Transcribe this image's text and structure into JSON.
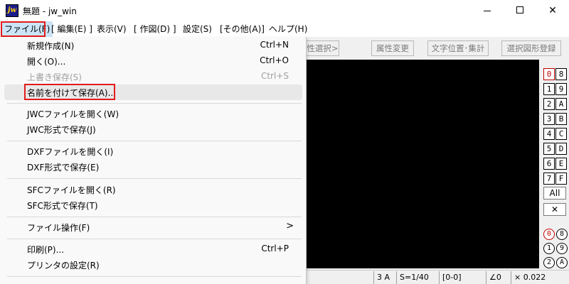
{
  "window": {
    "title": "無題 - jw_win",
    "app_icon_text": "jw",
    "minimize_glyph": "",
    "close_glyph": "✕"
  },
  "menubar": [
    {
      "label": "ファイル(F)"
    },
    {
      "label": "[ 編集(E) ]"
    },
    {
      "label": "表示(V)"
    },
    {
      "label": "[ 作図(D) ]"
    },
    {
      "label": "設定(S)"
    },
    {
      "label": "[その他(A)]"
    },
    {
      "label": "ヘルプ(H)"
    }
  ],
  "toolbar": [
    {
      "label": "性選択>"
    },
    {
      "label": "属性変更"
    },
    {
      "label": "文字位置･集計"
    },
    {
      "label": "選択図形登録"
    }
  ],
  "file_menu": [
    {
      "label": "新規作成(N)",
      "shortcut": "Ctrl+N",
      "enabled": true
    },
    {
      "label": "開く(O)...",
      "shortcut": "Ctrl+O",
      "enabled": true
    },
    {
      "label": "上書き保存(S)",
      "shortcut": "Ctrl+S",
      "enabled": false
    },
    {
      "label": "名前を付けて保存(A)...",
      "shortcut": "",
      "enabled": true,
      "highlighted": true
    },
    {
      "label": "JWCファイルを開く(W)",
      "shortcut": "",
      "enabled": true
    },
    {
      "label": "JWC形式で保存(J)",
      "shortcut": "",
      "enabled": true
    },
    {
      "label": "DXFファイルを開く(I)",
      "shortcut": "",
      "enabled": true
    },
    {
      "label": "DXF形式で保存(E)",
      "shortcut": "",
      "enabled": true
    },
    {
      "label": "SFCファイルを開く(R)",
      "shortcut": "",
      "enabled": true
    },
    {
      "label": "SFC形式で保存(T)",
      "shortcut": "",
      "enabled": true
    },
    {
      "label": "ファイル操作(F)",
      "shortcut": "",
      "enabled": true,
      "submenu_arrow": ">"
    },
    {
      "label": "印刷(P)...",
      "shortcut": "Ctrl+P",
      "enabled": true
    },
    {
      "label": "プリンタの設定(R)",
      "shortcut": "",
      "enabled": true
    }
  ],
  "layer_buttons": {
    "left": [
      "0",
      "1",
      "2",
      "3",
      "4",
      "5",
      "6",
      "7"
    ],
    "right": [
      "8",
      "9",
      "A",
      "B",
      "C",
      "D",
      "E",
      "F"
    ],
    "all_label": "All",
    "cross_label": "✕",
    "group_left": [
      "0",
      "1",
      "2"
    ],
    "group_right": [
      "8",
      "9",
      "A"
    ]
  },
  "statusbar": {
    "paper": "3 A",
    "scale": "S=1/40",
    "layer": "[0-0]",
    "angle": "∠0",
    "zoom": "× 0.022"
  },
  "colors": {
    "highlight_box": "#e21b1b",
    "canvas": "#000000",
    "selected_layer": "#c00000"
  }
}
